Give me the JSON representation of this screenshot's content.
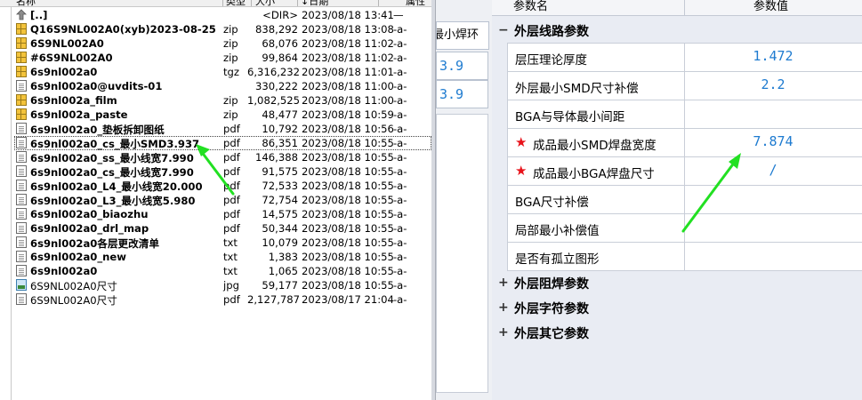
{
  "file_manager": {
    "columns": {
      "name": "名称",
      "type": "类型",
      "size": "大小",
      "date": "↓日期",
      "attr": "属性"
    },
    "files": [
      {
        "icon": "folder-up-icon",
        "name": "[..]",
        "ext": "",
        "size": "<DIR>",
        "date": "2023/08/18 13:41",
        "attr": "—",
        "bold": true
      },
      {
        "icon": "archive-icon",
        "name": "Q16S9NL002A0(xyb)2023-08-25",
        "ext": "zip",
        "size": "838,292",
        "date": "2023/08/18 13:08",
        "attr": "-a-",
        "bold": true
      },
      {
        "icon": "archive-icon",
        "name": "6S9NL002A0",
        "ext": "zip",
        "size": "68,076",
        "date": "2023/08/18 11:02",
        "attr": "-a-",
        "bold": true
      },
      {
        "icon": "archive-icon",
        "name": "#6S9NL002A0",
        "ext": "zip",
        "size": "99,864",
        "date": "2023/08/18 11:02",
        "attr": "-a-",
        "bold": true
      },
      {
        "icon": "archive-icon",
        "name": "6s9nl002a0",
        "ext": "tgz",
        "size": "6,316,232",
        "date": "2023/08/18 11:01",
        "attr": "-a-",
        "bold": true
      },
      {
        "icon": "document-icon",
        "name": "6s9nl002a0@uvdits-01",
        "ext": "",
        "size": "330,222",
        "date": "2023/08/18 11:00",
        "attr": "-a-",
        "bold": true
      },
      {
        "icon": "archive-icon",
        "name": "6s9nl002a_film",
        "ext": "zip",
        "size": "1,082,525",
        "date": "2023/08/18 11:00",
        "attr": "-a-",
        "bold": true
      },
      {
        "icon": "archive-icon",
        "name": "6s9nl002a_paste",
        "ext": "zip",
        "size": "48,477",
        "date": "2023/08/18 10:59",
        "attr": "-a-",
        "bold": true
      },
      {
        "icon": "document-icon",
        "name": "6s9nl002a0_垫板拆卸图纸",
        "ext": "pdf",
        "size": "10,792",
        "date": "2023/08/18 10:56",
        "attr": "-a-",
        "bold": true
      },
      {
        "icon": "document-icon",
        "name": "6s9nl002a0_cs_最小SMD3.937",
        "ext": "pdf",
        "size": "86,351",
        "date": "2023/08/18 10:55",
        "attr": "-a-",
        "bold": true,
        "selected": true
      },
      {
        "icon": "document-icon",
        "name": "6s9nl002a0_ss_最小线宽7.990",
        "ext": "pdf",
        "size": "146,388",
        "date": "2023/08/18 10:55",
        "attr": "-a-",
        "bold": true
      },
      {
        "icon": "document-icon",
        "name": "6s9nl002a0_cs_最小线宽7.990",
        "ext": "pdf",
        "size": "91,575",
        "date": "2023/08/18 10:55",
        "attr": "-a-",
        "bold": true
      },
      {
        "icon": "document-icon",
        "name": "6s9nl002a0_L4_最小线宽20.000",
        "ext": "pdf",
        "size": "72,533",
        "date": "2023/08/18 10:55",
        "attr": "-a-",
        "bold": true
      },
      {
        "icon": "document-icon",
        "name": "6s9nl002a0_L3_最小线宽5.980",
        "ext": "pdf",
        "size": "72,754",
        "date": "2023/08/18 10:55",
        "attr": "-a-",
        "bold": true
      },
      {
        "icon": "document-icon",
        "name": "6s9nl002a0_biaozhu",
        "ext": "pdf",
        "size": "14,575",
        "date": "2023/08/18 10:55",
        "attr": "-a-",
        "bold": true
      },
      {
        "icon": "document-icon",
        "name": "6s9nl002a0_drl_map",
        "ext": "pdf",
        "size": "50,344",
        "date": "2023/08/18 10:55",
        "attr": "-a-",
        "bold": true
      },
      {
        "icon": "document-icon",
        "name": "6s9nl002a0各层更改清单",
        "ext": "txt",
        "size": "10,079",
        "date": "2023/08/18 10:55",
        "attr": "-a-",
        "bold": true
      },
      {
        "icon": "document-icon",
        "name": "6s9nl002a0_new",
        "ext": "txt",
        "size": "1,383",
        "date": "2023/08/18 10:55",
        "attr": "-a-",
        "bold": true
      },
      {
        "icon": "document-icon",
        "name": "6s9nl002a0",
        "ext": "txt",
        "size": "1,065",
        "date": "2023/08/18 10:55",
        "attr": "-a-",
        "bold": true
      },
      {
        "icon": "image-icon",
        "name": "6S9NL002A0尺寸",
        "ext": "jpg",
        "size": "59,177",
        "date": "2023/08/18 10:55",
        "attr": "-a-",
        "bold": false
      },
      {
        "icon": "document-icon",
        "name": "6S9NL002A0尺寸",
        "ext": "pdf",
        "size": "2,127,787",
        "date": "2023/08/17 21:04",
        "attr": "-a-",
        "bold": false
      }
    ]
  },
  "middle": {
    "tab_label": "最小焊环",
    "values": [
      "3.9",
      "3.9"
    ]
  },
  "params": {
    "header": {
      "name": "参数名",
      "value": "参数值"
    },
    "open_group": {
      "sign": "−",
      "label": "外层线路参数"
    },
    "rows": [
      {
        "name": "层压理论厚度",
        "value": "1.472",
        "required": false
      },
      {
        "name": "外层最小SMD尺寸补偿",
        "value": "2.2",
        "required": false
      },
      {
        "name": "BGA与导体最小间距",
        "value": "",
        "required": false
      },
      {
        "name": "成品最小SMD焊盘宽度",
        "value": "7.874",
        "required": true
      },
      {
        "name": "成品最小BGA焊盘尺寸",
        "value": "/",
        "required": true
      },
      {
        "name": "BGA尺寸补偿",
        "value": "",
        "required": false
      },
      {
        "name": "局部最小补偿值",
        "value": "",
        "required": false
      },
      {
        "name": "是否有孤立图形",
        "value": "",
        "required": false
      }
    ],
    "collapsed_groups": [
      {
        "sign": "+",
        "label": "外层阻焊参数"
      },
      {
        "sign": "+",
        "label": "外层字符参数"
      },
      {
        "sign": "+",
        "label": "外层其它参数"
      }
    ]
  },
  "colors": {
    "value_blue": "#1e7bd0",
    "required_star": "#e8121a",
    "arrow_green": "#22e022"
  },
  "icons": {
    "required": "star-icon"
  }
}
